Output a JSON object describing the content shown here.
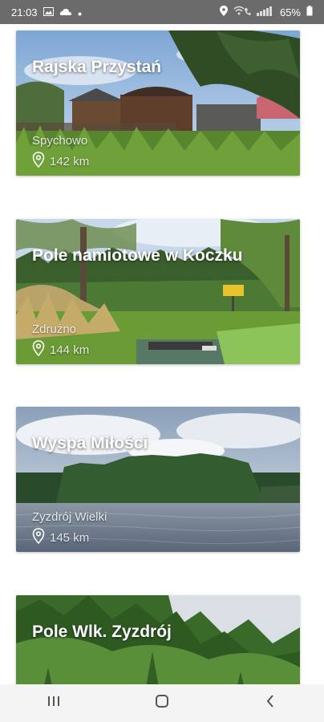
{
  "status_bar": {
    "time": "21:03",
    "battery": "65%",
    "icons": [
      "image-icon",
      "cloud-icon",
      "location-icon",
      "wifi-call-icon",
      "signal-icon",
      "battery-icon"
    ]
  },
  "places": [
    {
      "name": "Rajska Przystań",
      "location": "Spychowo",
      "distance": "142 km"
    },
    {
      "name": "Pole namiotowe w Koczku",
      "location": "Zdrużno",
      "distance": "144 km"
    },
    {
      "name": "Wyspa Miłości",
      "location": "Zyzdrój Wielki",
      "distance": "145 km"
    },
    {
      "name": "Pole Wlk. Zyzdrój",
      "location": "",
      "distance": ""
    }
  ],
  "nav_bar": {
    "icons": [
      "recents-icon",
      "home-icon",
      "back-icon"
    ]
  }
}
